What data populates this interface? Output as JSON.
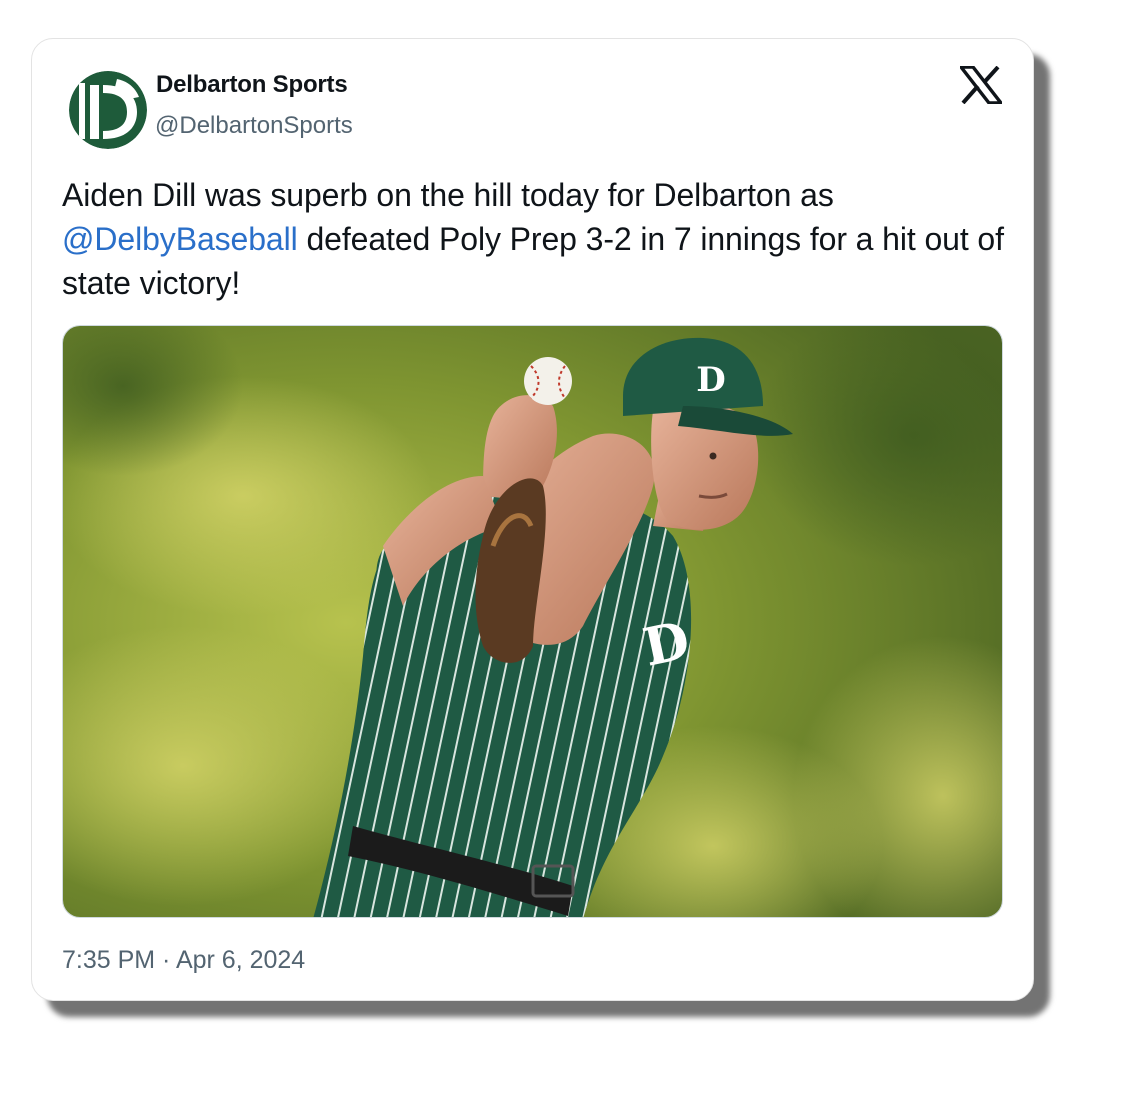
{
  "account": {
    "display_name": "Delbarton Sports",
    "handle": "@DelbartonSports",
    "avatar_icon": "delbarton-d-logo",
    "brand_color": "#1e5b3a"
  },
  "platform_icon": "x-logo-icon",
  "tweet": {
    "text_part1": "Aiden Dill was superb on the hill today for Delbarton as ",
    "mention": "@DelbyBaseball",
    "text_part2": " defeated Poly Prep 3-2 in 7 innings for a hit out of state victory!",
    "mention_color": "#2a6fc9"
  },
  "media": {
    "subject": "pitcher-photo"
  },
  "timestamp": "7:35 PM · Apr 6, 2024"
}
